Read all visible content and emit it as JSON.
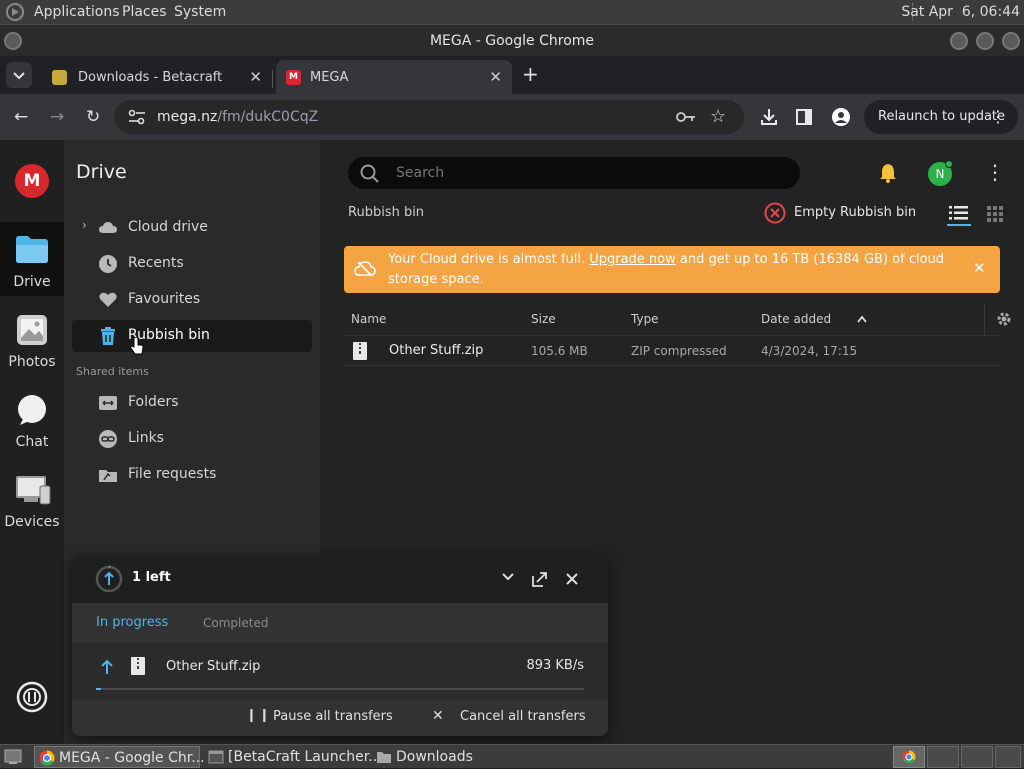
{
  "os_panel": {
    "menu": [
      "Applications",
      "Places",
      "System"
    ],
    "clock": "Sat Apr  6, 06:44"
  },
  "window": {
    "title": "MEGA - Google Chrome"
  },
  "tabs": [
    {
      "label": "Downloads - Betacraft",
      "active": false
    },
    {
      "label": "MEGA",
      "active": true
    }
  ],
  "address_bar": {
    "host": "mega.nz",
    "path": "/fm/dukC0CqZ",
    "relaunch_label": "Relaunch to update"
  },
  "rail": {
    "items": [
      {
        "label": "Drive",
        "icon": "drive-folder-icon"
      },
      {
        "label": "Photos",
        "icon": "photos-icon"
      },
      {
        "label": "Chat",
        "icon": "chat-bubble-icon"
      },
      {
        "label": "Devices",
        "icon": "devices-icon"
      }
    ]
  },
  "sidebar": {
    "title": "Drive",
    "items": [
      {
        "label": "Cloud drive",
        "icon": "cloud-icon"
      },
      {
        "label": "Recents",
        "icon": "clock-icon"
      },
      {
        "label": "Favourites",
        "icon": "heart-icon"
      },
      {
        "label": "Rubbish bin",
        "icon": "trash-icon",
        "selected": true
      }
    ],
    "shared_heading": "Shared items",
    "shared_items": [
      {
        "label": "Folders",
        "icon": "shared-folder-icon"
      },
      {
        "label": "Links",
        "icon": "link-icon"
      },
      {
        "label": "File requests",
        "icon": "file-request-icon"
      }
    ]
  },
  "main": {
    "search_placeholder": "Search",
    "avatar_initial": "N",
    "breadcrumb": "Rubbish bin",
    "empty_bin_label": "Empty Rubbish bin",
    "banner": {
      "text_before": "Your Cloud drive is almost full. ",
      "link": "Upgrade now",
      "text_after": " and get up to 16 TB (16384 GB) of cloud storage space."
    },
    "columns": [
      "Name",
      "Size",
      "Type",
      "Date added"
    ],
    "rows": [
      {
        "name": "Other Stuff.zip",
        "size": "105.6 MB",
        "type": "ZIP compressed",
        "date": "4/3/2024, 17:15"
      }
    ]
  },
  "transfers": {
    "count_label": "1 left",
    "tab_in_progress": "In progress",
    "tab_completed": "Completed",
    "item": {
      "name": "Other Stuff.zip",
      "speed": "893 KB/s",
      "progress": 0.01
    },
    "pause_label": "Pause all transfers",
    "cancel_label": "Cancel all transfers"
  },
  "taskbar": {
    "items": [
      "MEGA - Google Chr...",
      "[BetaCraft Launcher...",
      "Downloads"
    ]
  },
  "colors": {
    "mega_red": "#d9272e",
    "banner_orange": "#f5a443",
    "accent_blue": "#4fb3e8",
    "online_green": "#2bb34a"
  }
}
